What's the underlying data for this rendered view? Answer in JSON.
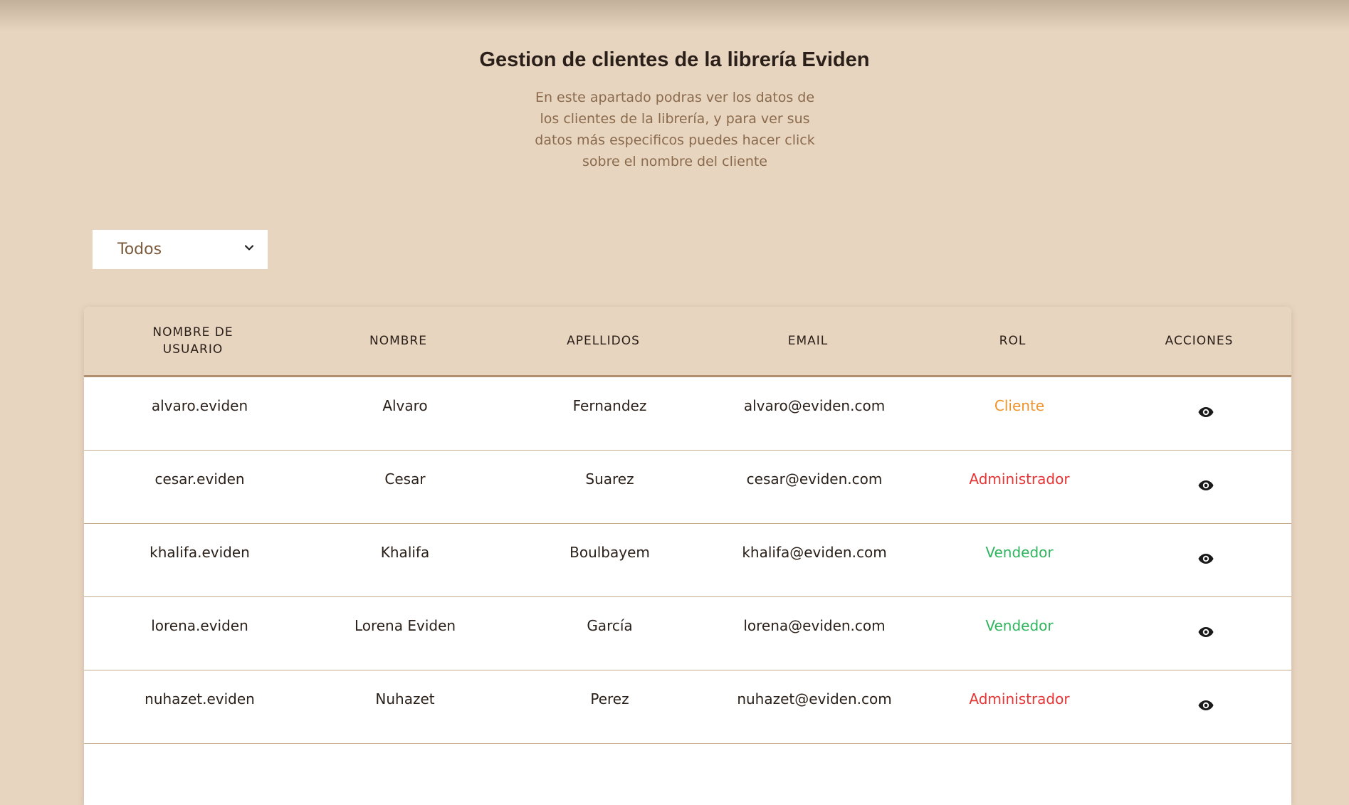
{
  "header": {
    "title": "Gestion de clientes de la librería Eviden",
    "subtitle": "En este apartado podras ver los datos de los clientes de la librería, y para ver sus datos más especificos puedes hacer click sobre el nombre del cliente"
  },
  "filter": {
    "selected": "Todos",
    "icon": "chevron-down-icon"
  },
  "table": {
    "columns": [
      "NOMBRE DE USUARIO",
      "NOMBRE",
      "APELLIDOS",
      "EMAIL",
      "ROL",
      "ACCIONES"
    ],
    "rows": [
      {
        "username": "alvaro.eviden",
        "name": "Alvaro",
        "surname": "Fernandez",
        "email": "alvaro@eviden.com",
        "role": "Cliente",
        "role_color": "#f0932b",
        "action_icon": "eye-icon"
      },
      {
        "username": "cesar.eviden",
        "name": "Cesar",
        "surname": "Suarez",
        "email": "cesar@eviden.com",
        "role": "Administrador",
        "role_color": "#e63535",
        "action_icon": "eye-icon"
      },
      {
        "username": "khalifa.eviden",
        "name": "Khalifa",
        "surname": "Boulbayem",
        "email": "khalifa@eviden.com",
        "role": "Vendedor",
        "role_color": "#2eb45c",
        "action_icon": "eye-icon"
      },
      {
        "username": "lorena.eviden",
        "name": "Lorena Eviden",
        "surname": "García",
        "email": "lorena@eviden.com",
        "role": "Vendedor",
        "role_color": "#2eb45c",
        "action_icon": "eye-icon"
      },
      {
        "username": "nuhazet.eviden",
        "name": "Nuhazet",
        "surname": "Perez",
        "email": "nuhazet@eviden.com",
        "role": "Administrador",
        "role_color": "#e63535",
        "action_icon": "eye-icon"
      }
    ]
  },
  "colors": {
    "background": "#e8d5c0",
    "header_border": "#b08e6e",
    "subtitle": "#8a6a4c"
  }
}
